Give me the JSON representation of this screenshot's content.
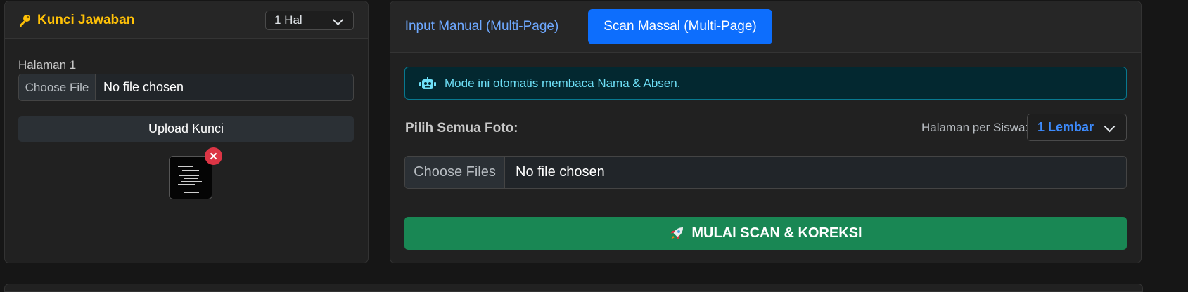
{
  "answer_key": {
    "title": "Kunci Jawaban",
    "icon": "key-icon",
    "page_select": {
      "selected": "1 Hal"
    },
    "page_label": "Halaman 1",
    "file_input": {
      "button": "Choose File",
      "status": "No file chosen"
    },
    "upload_button": "Upload Kunci",
    "thumbnail": {
      "remove_symbol": "✕"
    }
  },
  "scan_panel": {
    "tabs": [
      {
        "label": "Input Manual (Multi-Page)",
        "active": false
      },
      {
        "label": "Scan Massal (Multi-Page)",
        "active": true
      }
    ],
    "info_alert": {
      "icon": "robot-icon",
      "text": "Mode ini otomatis membaca Nama & Absen."
    },
    "pick_label": "Pilih Semua Foto:",
    "pages_per_student_label": "Halaman per Siswa:",
    "pages_per_student_select": {
      "selected": "1 Lembar"
    },
    "file_input": {
      "button": "Choose Files",
      "status": "No file chosen"
    },
    "scan_button": {
      "icon": "rocket-icon",
      "label": "MULAI SCAN & KOREKSI"
    }
  },
  "colors": {
    "background": "#161616",
    "card": "#212121",
    "title_accent": "#ffc107",
    "primary": "#0d6efd",
    "info_bg": "#032830",
    "info_text": "#6edff6",
    "success": "#198754",
    "danger": "#dc3545"
  }
}
